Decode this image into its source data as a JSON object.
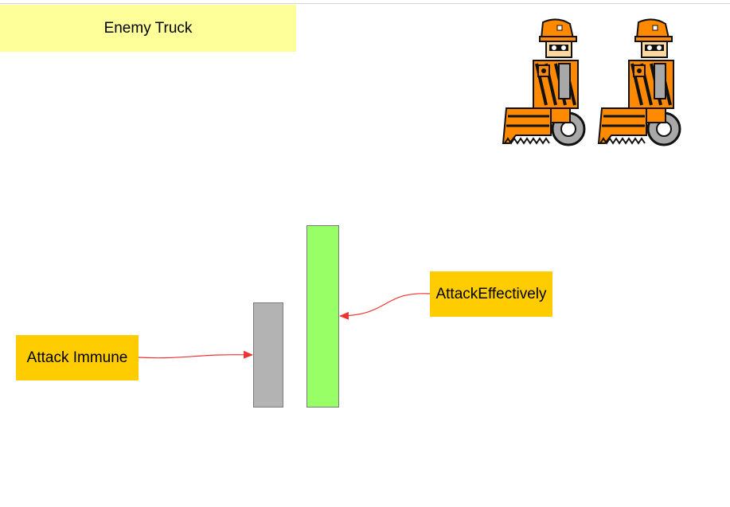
{
  "title": "Enemy Truck",
  "labels": {
    "immune": "Attack Immune",
    "effective": "AttackEffectively"
  },
  "colors": {
    "title_fill": "#ffff99",
    "label_fill": "#ffcc00",
    "immune_bar": "#b3b3b3",
    "effective_bar": "#99ff66",
    "arrow": "#ee3333",
    "sprite_orange": "#ff8a00",
    "sprite_black": "#111111",
    "sprite_gray": "#a8a8a8"
  },
  "sprites": [
    {
      "icon": "construction-bulldozer-robot-icon"
    },
    {
      "icon": "construction-bulldozer-robot-icon"
    }
  ]
}
